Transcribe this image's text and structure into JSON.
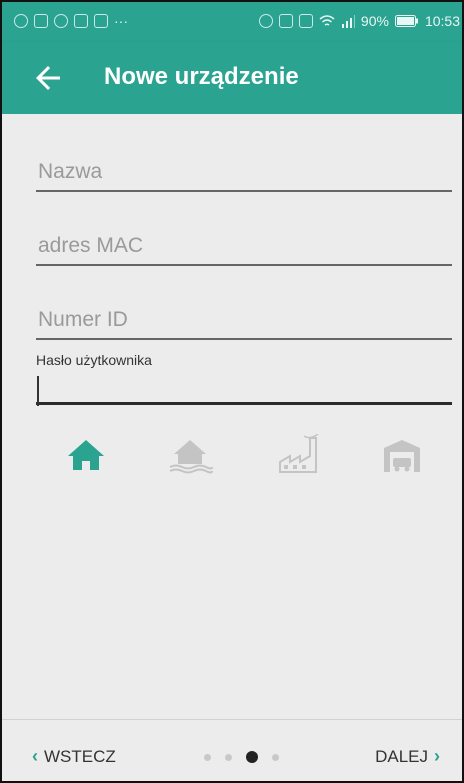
{
  "statusbar": {
    "left_icons": [
      "fm-radio-icon",
      "mail-icon",
      "location-icon",
      "youtube-icon",
      "message-icon"
    ],
    "more": "···",
    "battery": "90%",
    "time": "10:53"
  },
  "appbar": {
    "title": "Nowe urządzenie"
  },
  "form": {
    "name_placeholder": "Nazwa",
    "mac_placeholder": "adres MAC",
    "id_placeholder": "Numer ID",
    "password_label": "Hasło użytkownika",
    "password_value": ""
  },
  "device_types": [
    {
      "icon": "house-icon",
      "selected": true
    },
    {
      "icon": "flood-house-icon",
      "selected": false
    },
    {
      "icon": "factory-icon",
      "selected": false
    },
    {
      "icon": "garage-icon",
      "selected": false
    }
  ],
  "footer": {
    "back_label": "WSTECZ",
    "next_label": "DALEJ",
    "page_count": 4,
    "current_page": 3
  },
  "colors": {
    "accent": "#2aa391",
    "background": "#ececec",
    "inactive_icon": "#c4c4c4"
  }
}
